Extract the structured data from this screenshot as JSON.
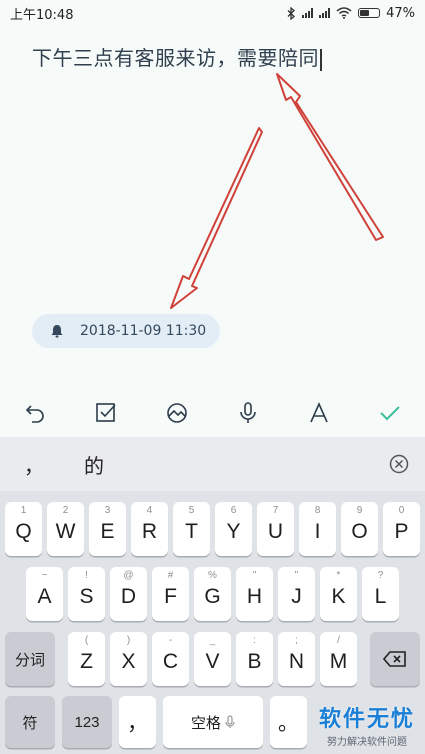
{
  "status_bar": {
    "time": "上午10:48",
    "battery": "47%",
    "icons": [
      "bluetooth-icon",
      "signal-icon",
      "signal-icon",
      "wifi-icon",
      "battery-icon"
    ]
  },
  "note": {
    "text": "下午三点有客服来访，需要陪同"
  },
  "reminder": {
    "datetime": "2018-11-09 11:30",
    "icon": "bell-icon"
  },
  "toolbar": {
    "icons": [
      "undo-icon",
      "checkbox-icon",
      "image-icon",
      "microphone-icon",
      "text-format-icon",
      "done-check-icon"
    ],
    "accent": "#3dbf9a"
  },
  "candidates": {
    "items": [
      "，",
      "的"
    ],
    "close_icon": "close-circle-icon"
  },
  "keyboard": {
    "row1": [
      {
        "main": "Q",
        "sub": "1"
      },
      {
        "main": "W",
        "sub": "2"
      },
      {
        "main": "E",
        "sub": "3"
      },
      {
        "main": "R",
        "sub": "4"
      },
      {
        "main": "T",
        "sub": "5"
      },
      {
        "main": "Y",
        "sub": "6"
      },
      {
        "main": "U",
        "sub": "7"
      },
      {
        "main": "I",
        "sub": "8"
      },
      {
        "main": "O",
        "sub": "9"
      },
      {
        "main": "P",
        "sub": "0"
      }
    ],
    "row2": [
      {
        "main": "A",
        "sub": "~"
      },
      {
        "main": "S",
        "sub": "!"
      },
      {
        "main": "D",
        "sub": "@"
      },
      {
        "main": "F",
        "sub": "#"
      },
      {
        "main": "G",
        "sub": "%"
      },
      {
        "main": "H",
        "sub": "\""
      },
      {
        "main": "J",
        "sub": "\""
      },
      {
        "main": "K",
        "sub": "*"
      },
      {
        "main": "L",
        "sub": "?"
      }
    ],
    "row3": [
      {
        "main": "Z",
        "sub": "("
      },
      {
        "main": "X",
        "sub": ")"
      },
      {
        "main": "C",
        "sub": "-"
      },
      {
        "main": "V",
        "sub": "_"
      },
      {
        "main": "B",
        "sub": ":"
      },
      {
        "main": "N",
        "sub": ";"
      },
      {
        "main": "M",
        "sub": "/"
      }
    ],
    "fenci": "分词",
    "symbol": "符",
    "num": "123",
    "comma": "，",
    "space": "空格",
    "period": "。"
  },
  "watermark": {
    "title": "软件无忧",
    "subtitle": "努力解决软件问题"
  },
  "colors": {
    "annotation_arrow": "#d0413a",
    "background": "#f6fbfa",
    "keyboard_bg": "#dfe2e6"
  }
}
